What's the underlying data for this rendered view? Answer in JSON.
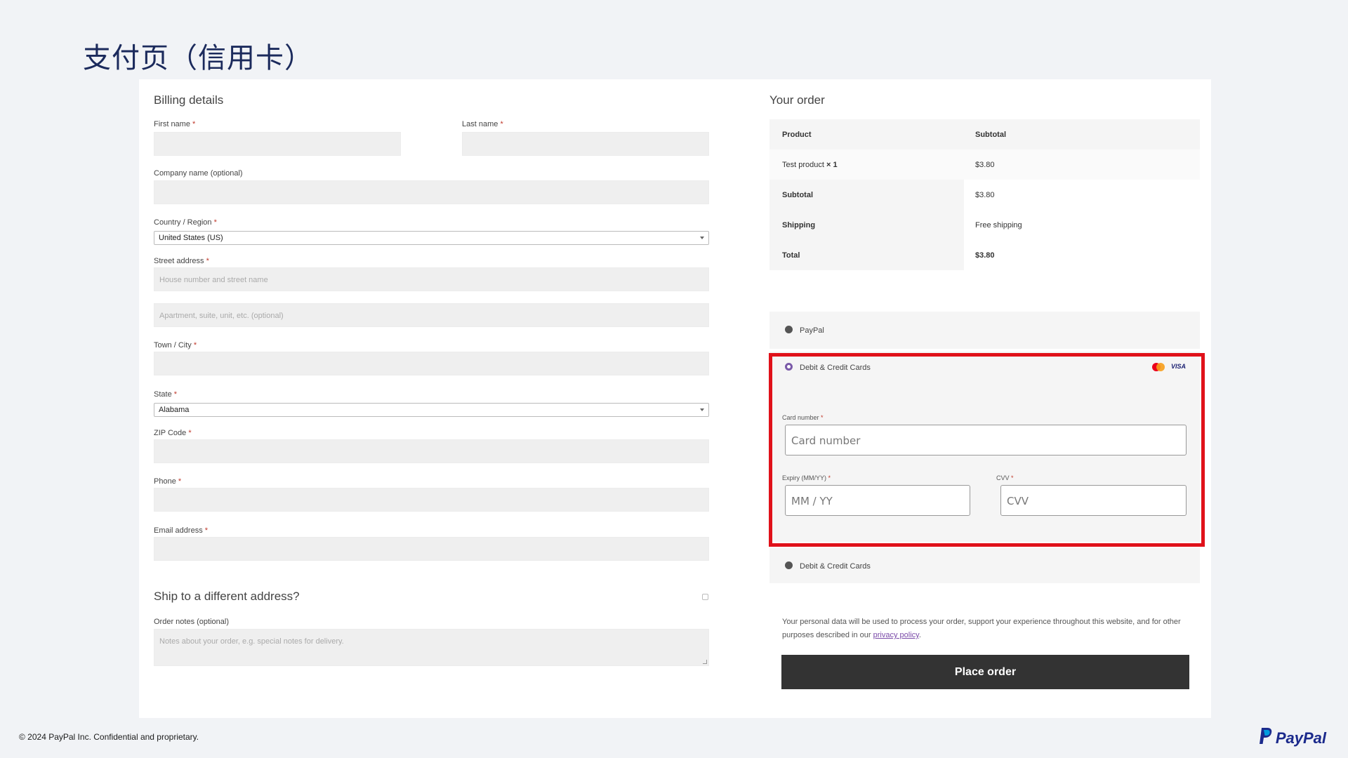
{
  "slide": {
    "title": "支付页（信用卡）"
  },
  "billing": {
    "title": "Billing details",
    "first_name_label": "First name",
    "last_name_label": "Last name",
    "company_label": "Company name (optional)",
    "country_label": "Country / Region",
    "country_value": "United States (US)",
    "street_label": "Street address",
    "street_placeholder": "House number and street name",
    "street2_placeholder": "Apartment, suite, unit, etc. (optional)",
    "city_label": "Town / City",
    "state_label": "State",
    "state_value": "Alabama",
    "zip_label": "ZIP Code",
    "phone_label": "Phone",
    "email_label": "Email address",
    "required_mark": "*",
    "ship_title": "Ship to a different address?",
    "notes_label": "Order notes (optional)",
    "notes_placeholder": "Notes about your order, e.g. special notes for delivery."
  },
  "order": {
    "title": "Your order",
    "header": {
      "product": "Product",
      "subtotal": "Subtotal"
    },
    "rows": [
      {
        "label": "Test product",
        "qty": "× 1",
        "value": "$3.80"
      },
      {
        "label": "Subtotal",
        "value": "$3.80"
      },
      {
        "label": "Shipping",
        "value": "Free shipping"
      },
      {
        "label": "Total",
        "value": "$3.80"
      }
    ]
  },
  "payment": {
    "paypal_label": "PayPal",
    "cards_label": "Debit & Credit Cards",
    "card_brands": [
      "mastercard-icon",
      "visa-icon"
    ],
    "visa_text": "VISA",
    "card_number_label": "Card number",
    "card_number_placeholder": "Card number",
    "expiry_label": "Expiry (MM/YY)",
    "expiry_placeholder": "MM / YY",
    "cvv_label": "CVV",
    "cvv_placeholder": "CVV",
    "cards_label_2": "Debit & Credit Cards"
  },
  "privacy": {
    "text": "Your personal data will be used to process your order, support your experience throughout this website, and for other purposes described in our",
    "link": "privacy policy",
    "end": "."
  },
  "place_order": "Place order",
  "footer": {
    "copyright": "© 2024 PayPal Inc. Confidential and proprietary.",
    "brand": "PayPal"
  },
  "colors": {
    "highlight": "#e0111a",
    "button": "#333333",
    "brand": "#1b2a8c",
    "radio_selected": "#7a5aa8"
  }
}
